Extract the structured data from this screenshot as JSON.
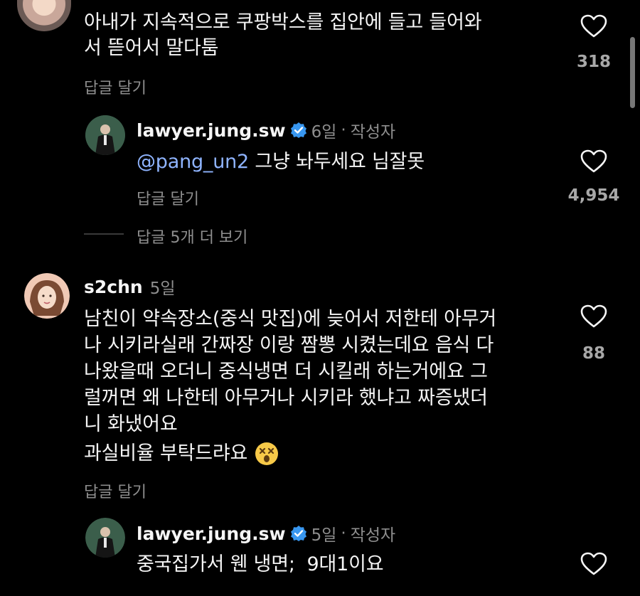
{
  "comments": [
    {
      "text_line1": "아내가 지속적으로 쿠팡박스를 집안에 들고 들어와",
      "text_line2": "서 뜯어서 말다툼",
      "reply_label": "답글 달기",
      "likes": "318",
      "icon": "heart-outline-icon"
    },
    {
      "username": "lawyer.jung.sw",
      "verified_icon": "verified-badge-icon",
      "age": "6일",
      "separator": "·",
      "role": "작성자",
      "mention": "@pang_un2",
      "text": " 그냥 놔두세요 님잘못",
      "reply_label": "답글 달기",
      "likes": "4,954",
      "icon": "heart-outline-icon"
    },
    {
      "view_replies": "답글 5개 더 보기"
    },
    {
      "username": "s2chn",
      "age": "5일",
      "lines": [
        "남친이 약속장소(중식 맛집)에 늦어서 저한테 아무거",
        "나 시키라실래 간짜장 이랑 짬뽕 시켰는데요 음식 다",
        "나왔을때 오더니 중식냉면 더 시킬래 하는거에요 그",
        "럴꺼면 왜 나한테 아무거나 시키라 했냐고 짜증냈더",
        "니 화냈어요"
      ],
      "line_last": "과실비율 부탁드랴요",
      "emoji": "😵",
      "reply_label": "답글 달기",
      "likes": "88",
      "icon": "heart-outline-icon"
    },
    {
      "username": "lawyer.jung.sw",
      "age": "5일",
      "separator": "·",
      "role": "작성자",
      "text": "중국집가서 웬 냉면;  9대1이요",
      "icon": "heart-outline-icon"
    }
  ],
  "colors": {
    "background": "#000000",
    "text": "#f5f5f5",
    "muted": "#8e8e8e",
    "mention": "#8fb4ff",
    "verified": "#3897f0"
  }
}
